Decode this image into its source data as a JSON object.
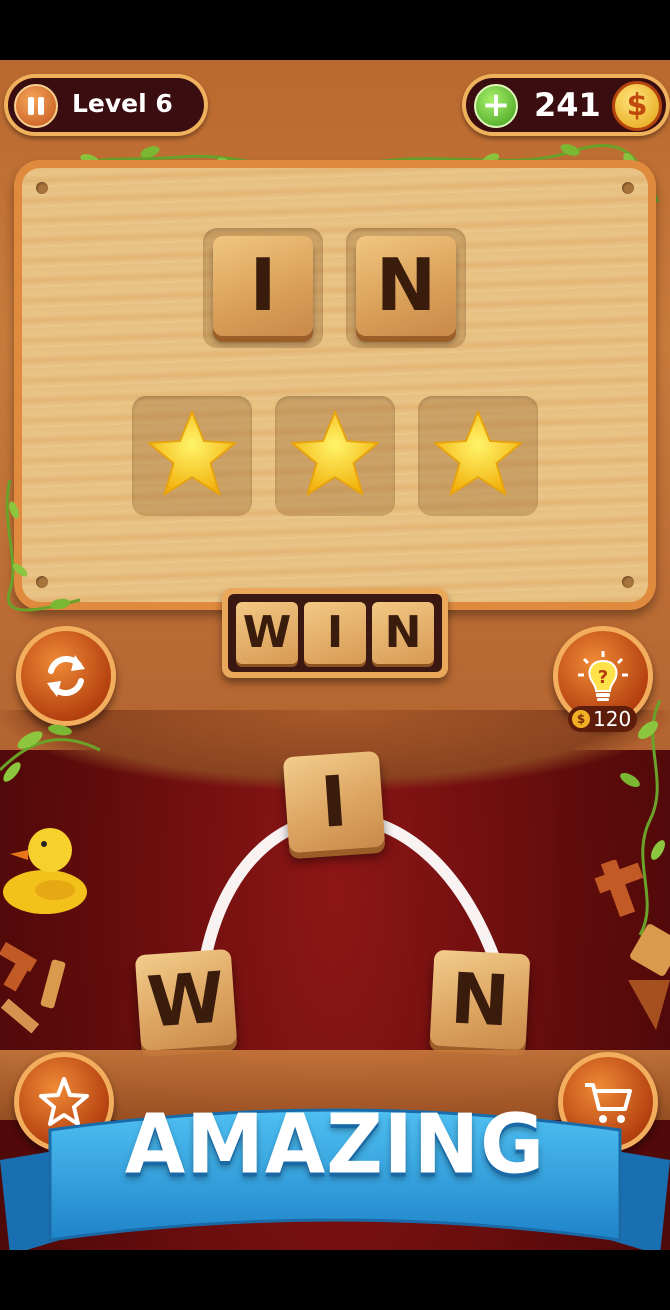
{
  "hud": {
    "level_label": "Level 6",
    "coins": "241",
    "coin_symbol": "$",
    "plus_symbol": "+"
  },
  "board": {
    "found_word_letters": [
      "I",
      "N"
    ],
    "slots_stars": 3
  },
  "preview": {
    "letters": [
      "W",
      "I",
      "N"
    ]
  },
  "hint": {
    "cost": "120",
    "coin_symbol": "$"
  },
  "wheel": {
    "letters": [
      "I",
      "W",
      "N"
    ]
  },
  "banner": {
    "text": "AMAZING"
  },
  "colors": {
    "wood": "#c97b3c",
    "felt": "#7a1010",
    "banner_blue": "#2a9ad9",
    "star_yellow": "#ffd21a"
  }
}
